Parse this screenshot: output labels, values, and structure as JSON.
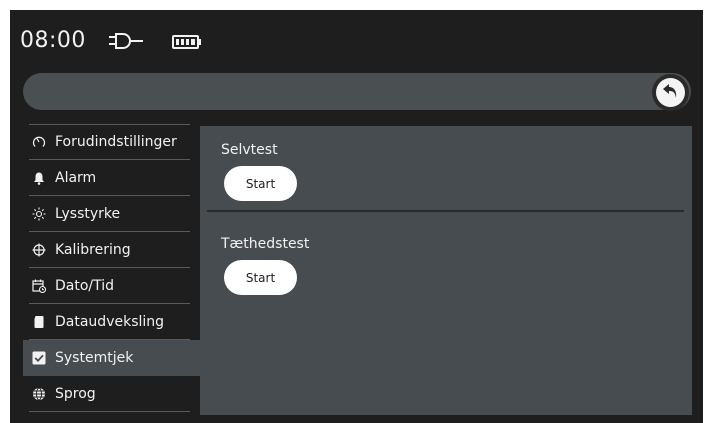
{
  "status": {
    "time": "08:00",
    "plug_icon": "power-plug-icon",
    "battery_icon": "battery-full-icon"
  },
  "header": {
    "search_value": "",
    "back_icon": "undo-arrow-icon"
  },
  "sidebar": {
    "items": [
      {
        "label": "Forudindstillinger",
        "icon": "gauge-icon",
        "active": false
      },
      {
        "label": "Alarm",
        "icon": "bell-icon",
        "active": false
      },
      {
        "label": "Lysstyrke",
        "icon": "sun-icon",
        "active": false
      },
      {
        "label": "Kalibrering",
        "icon": "crosshair-icon",
        "active": false
      },
      {
        "label": "Dato/Tid",
        "icon": "calendar-clock-icon",
        "active": false
      },
      {
        "label": "Dataudveksling",
        "icon": "sd-card-icon",
        "active": false
      },
      {
        "label": "Systemtjek",
        "icon": "checkbox-icon",
        "active": true
      },
      {
        "label": "Sprog",
        "icon": "globe-icon",
        "active": false
      }
    ]
  },
  "main": {
    "sections": [
      {
        "title": "Selvtest",
        "button_label": "Start"
      },
      {
        "title": "Tæthedstest",
        "button_label": "Start"
      }
    ]
  },
  "colors": {
    "background": "#1e1e1e",
    "panel": "#464c50",
    "search_bar": "#4a4f52",
    "text": "#f2f2f2",
    "button": "#ffffff"
  }
}
